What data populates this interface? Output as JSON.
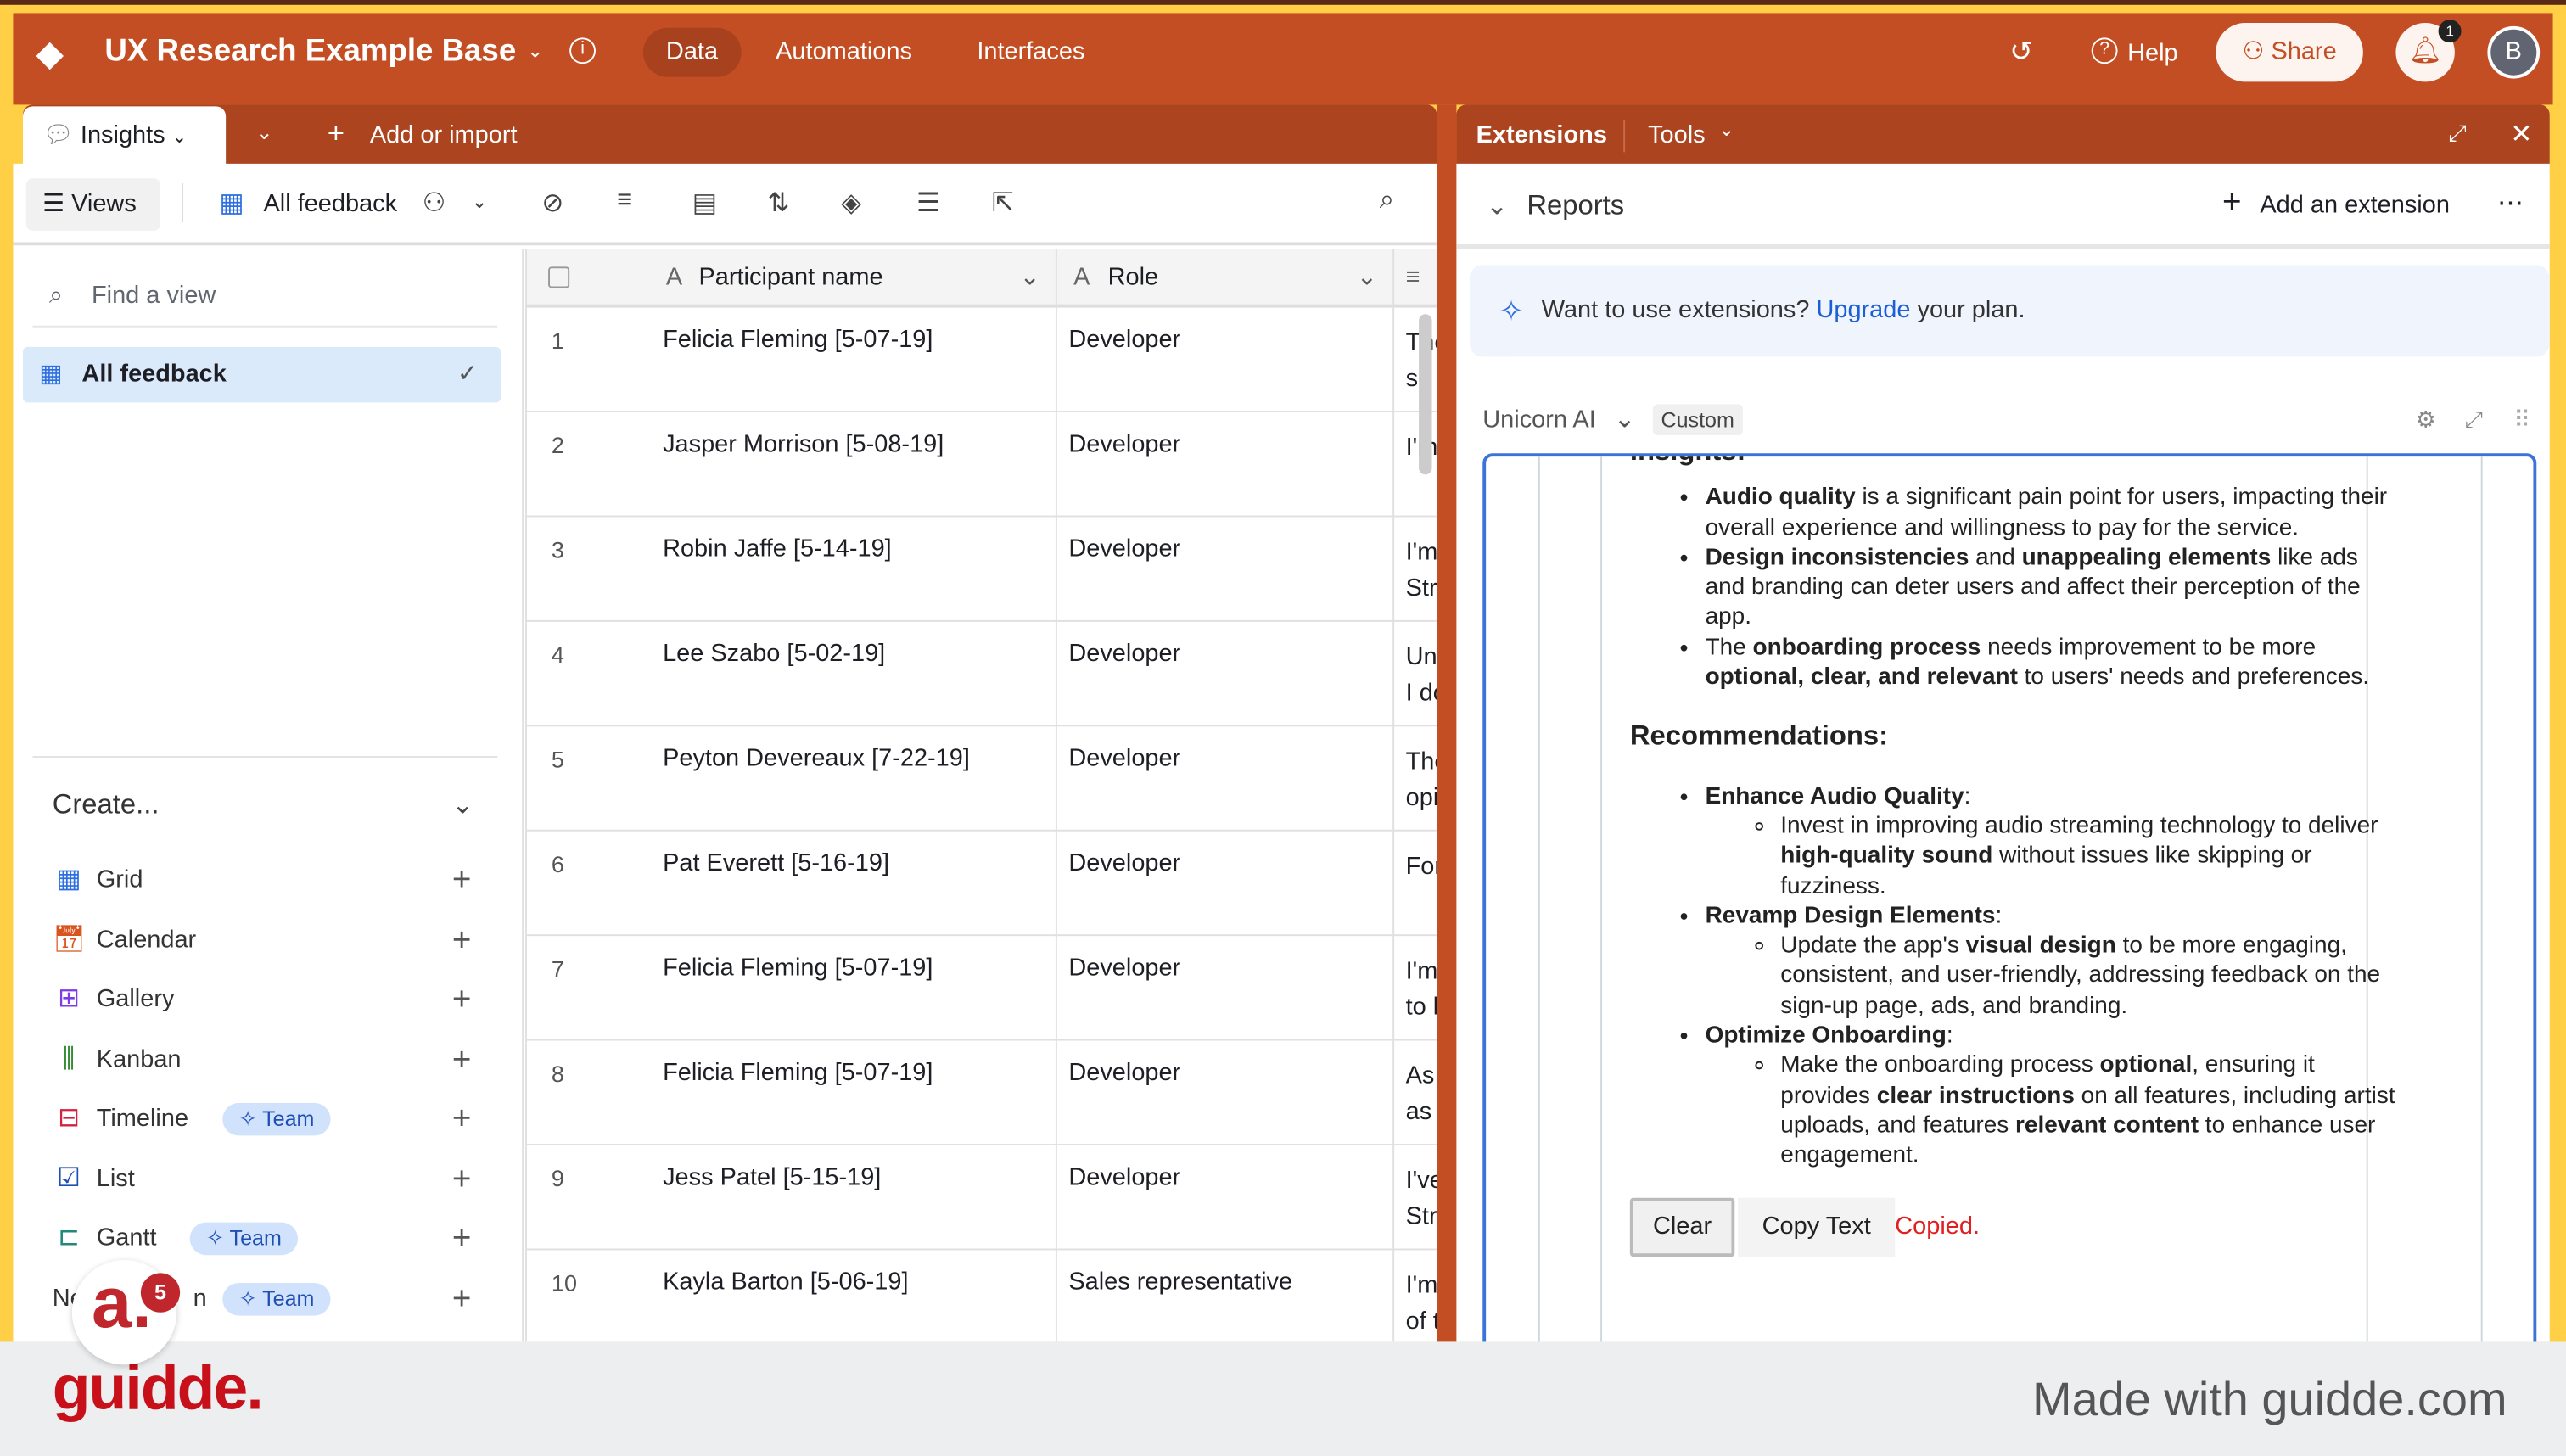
{
  "header": {
    "base_name": "UX Research Example Base",
    "nav": [
      "Data",
      "Automations",
      "Interfaces"
    ],
    "active_nav": "Data",
    "help": "Help",
    "share": "Share",
    "notification_count": "1",
    "avatar_initial": "B"
  },
  "tabs": {
    "active": "Insights",
    "add": "Add or import"
  },
  "toolbar": {
    "views": "Views",
    "view_name": "All feedback"
  },
  "sidebar": {
    "find_placeholder": "Find a view",
    "selected_view": "All feedback",
    "create_label": "Create...",
    "create_items": [
      {
        "label": "Grid",
        "icon": "grid-icon",
        "color": "#2d6fe0"
      },
      {
        "label": "Calendar",
        "icon": "calendar-icon",
        "color": "#d9541e",
        "glyph": "31"
      },
      {
        "label": "Gallery",
        "icon": "gallery-icon",
        "color": "#7c3aed"
      },
      {
        "label": "Kanban",
        "icon": "kanban-icon",
        "color": "#2f8a2f"
      },
      {
        "label": "Timeline",
        "icon": "timeline-icon",
        "color": "#d4213d",
        "badge": "Team"
      },
      {
        "label": "List",
        "icon": "list-icon",
        "color": "#1f4fb5"
      },
      {
        "label": "Gantt",
        "icon": "gantt-icon",
        "color": "#1f8a7a",
        "badge": "Team"
      },
      {
        "label": "Ne",
        "suffix": "n",
        "icon": "new-section-icon",
        "color": "#333",
        "badge": "Team"
      }
    ]
  },
  "grid": {
    "columns": [
      "Participant name",
      "Role"
    ],
    "rows": [
      {
        "num": "1",
        "name": "Felicia Fleming [5-07-19]",
        "role": "Developer",
        "fb": [
          "The",
          "so"
        ]
      },
      {
        "num": "2",
        "name": "Jasper Morrison [5-08-19]",
        "role": "Developer",
        "fb": [
          "I'm",
          ""
        ]
      },
      {
        "num": "3",
        "name": "Robin Jaffe [5-14-19]",
        "role": "Developer",
        "fb": [
          "I'm",
          "Str"
        ]
      },
      {
        "num": "4",
        "name": "Lee Szabo [5-02-19]",
        "role": "Developer",
        "fb": [
          "Un",
          "I do"
        ]
      },
      {
        "num": "5",
        "name": "Peyton Devereaux [7-22-19]",
        "role": "Developer",
        "fb": [
          "The",
          "opi"
        ]
      },
      {
        "num": "6",
        "name": "Pat Everett [5-16-19]",
        "role": "Developer",
        "fb": [
          "For",
          ""
        ]
      },
      {
        "num": "7",
        "name": "Felicia Fleming [5-07-19]",
        "role": "Developer",
        "fb": [
          "I'm",
          "to l"
        ]
      },
      {
        "num": "8",
        "name": "Felicia Fleming [5-07-19]",
        "role": "Developer",
        "fb": [
          "As",
          "as"
        ]
      },
      {
        "num": "9",
        "name": "Jess Patel [5-15-19]",
        "role": "Developer",
        "fb": [
          "I've",
          "Str"
        ]
      },
      {
        "num": "10",
        "name": "Kayla Barton [5-06-19]",
        "role": "Sales representative",
        "fb": [
          "I'm",
          "of t"
        ]
      }
    ]
  },
  "extensions": {
    "title": "Extensions",
    "tools": "Tools",
    "reports": "Reports",
    "add_extension": "Add an extension",
    "upgrade_pre": "Want to use extensions? ",
    "upgrade_link": "Upgrade",
    "upgrade_post": " your plan.",
    "extension_name": "Unicorn AI",
    "custom_tag": "Custom",
    "insights_heading": "Insights:",
    "insights": [
      [
        [
          "Audio quality",
          true
        ],
        [
          " is a significant pain point for users, impacting their overall experience and willingness to pay for the service.",
          false
        ]
      ],
      [
        [
          "Design inconsistencies",
          true
        ],
        [
          " and ",
          false
        ],
        [
          "unappealing elements",
          true
        ],
        [
          " like ads and branding can deter users and affect their perception of the app.",
          false
        ]
      ],
      [
        [
          "The ",
          false
        ],
        [
          "onboarding process",
          true
        ],
        [
          " needs improvement to be more ",
          false
        ],
        [
          "optional, clear, and relevant",
          true
        ],
        [
          " to users' needs and preferences.",
          false
        ]
      ]
    ],
    "recommendations_heading": "Recommendations:",
    "recommendations": [
      {
        "title": "Enhance Audio Quality",
        "sub": [
          [
            "Invest in improving audio streaming technology to deliver ",
            false
          ],
          [
            "high-quality sound",
            true
          ],
          [
            " without issues like skipping or fuzziness.",
            false
          ]
        ]
      },
      {
        "title": "Revamp Design Elements",
        "sub": [
          [
            "Update the app's ",
            false
          ],
          [
            "visual design",
            true
          ],
          [
            " to be more engaging, consistent, and user-friendly, addressing feedback on the sign-up page, ads, and branding.",
            false
          ]
        ]
      },
      {
        "title": "Optimize Onboarding",
        "sub": [
          [
            "Make the onboarding process ",
            false
          ],
          [
            "optional",
            true
          ],
          [
            ", ensuring it provides ",
            false
          ],
          [
            "clear instructions",
            true
          ],
          [
            " on all features, including artist uploads, and features ",
            false
          ],
          [
            "relevant content",
            true
          ],
          [
            " to enhance user engagement.",
            false
          ]
        ]
      }
    ],
    "clear": "Clear",
    "copy": "Copy Text",
    "copied": "Copied."
  },
  "footer": {
    "brand": "guidde.",
    "made_with": "Made with guidde.com",
    "bubble_badge": "5"
  },
  "colors": {
    "header": "#c44e23",
    "tabbar": "#ad4420",
    "accent_blue": "#2d6fe0",
    "copied_red": "#e02020"
  }
}
